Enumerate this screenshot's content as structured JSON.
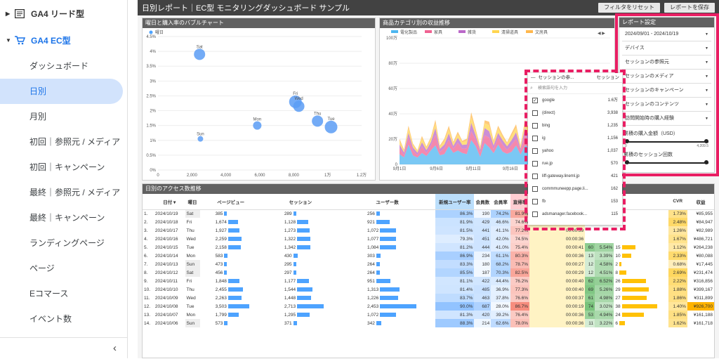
{
  "sidebar": {
    "group1": "GA4 リード型",
    "group2": "GA4 EC型",
    "items": [
      "ダッシュボード",
      "日別",
      "月別",
      "初回｜参照元 / メディア",
      "初回｜キャンペーン",
      "最終｜参照元 / メディア",
      "最終｜キャンペーン",
      "ランディングページ",
      "ページ",
      "Eコマース",
      "イベント数"
    ],
    "collapse": "‹"
  },
  "header": {
    "title": "日別レポート｜EC型 モニタリングダッシュボード サンプル",
    "reset": "フィルタをリセット",
    "save": "レポートを保存"
  },
  "bubble": {
    "title": "曜日と購入率のバブルチャート",
    "legend": "曜日",
    "yticks": [
      "4.5%",
      "4%",
      "3.5%",
      "3%",
      "2.5%",
      "2%",
      "1.5%",
      "1%",
      "0.5%",
      "0%"
    ],
    "xticks": [
      "0",
      "2,000",
      "4,000",
      "6,000",
      "8,000",
      "1万",
      "1.2万"
    ],
    "points": [
      {
        "label": "Sat",
        "x": 2450,
        "y": 3.9,
        "r": 8
      },
      {
        "label": "Sun",
        "x": 2500,
        "y": 1.05,
        "r": 4
      },
      {
        "label": "Mon",
        "x": 5850,
        "y": 1.5,
        "r": 6
      },
      {
        "label": "Fri",
        "x": 8100,
        "y": 2.3,
        "r": 9
      },
      {
        "label": "Wed",
        "x": 8300,
        "y": 2.15,
        "r": 8
      },
      {
        "label": "Thu",
        "x": 9400,
        "y": 1.65,
        "r": 8
      },
      {
        "label": "Tue",
        "x": 10200,
        "y": 1.45,
        "r": 9
      }
    ]
  },
  "area": {
    "title": "商品カテゴリ別の収益推移",
    "legend": [
      "電化製品",
      "家具",
      "雑貨",
      "清掃道具",
      "文房具"
    ],
    "colors": [
      "#4db6f0",
      "#f06292",
      "#ba68c8",
      "#ffd54f",
      "#ffb74d"
    ],
    "yticks": [
      "100万",
      "80万",
      "60万",
      "40万",
      "20万",
      "0"
    ],
    "xticks": [
      "9月1日",
      "9月6日",
      "9月11日",
      "9月16日",
      "9月21日",
      "9月26日"
    ],
    "pager": "◀ ▶"
  },
  "settings": {
    "title": "レポート設定",
    "date": "2024/09/01 - 2024/10/19",
    "filters": [
      "デバイス",
      "セッションの参照元",
      "セッションのメディア",
      "セッションのキャンペーン",
      "セッションのコンテンツ",
      "訪問開始時の購入経験"
    ],
    "slider1": "累積の購入金額（USD）",
    "slider1_nums": [
      "0",
      "4,209.5"
    ],
    "slider2": "累積のセッション回数"
  },
  "dropdown": {
    "header": "セッションの参...",
    "header2": "セッション",
    "search": "検索語句を入力",
    "items": [
      {
        "name": "google",
        "value": "1.6万",
        "checked": "✓"
      },
      {
        "name": "(direct)",
        "value": "3,938",
        "checked": ""
      },
      {
        "name": "bing",
        "value": "1,235",
        "checked": ""
      },
      {
        "name": "ig",
        "value": "1,156",
        "checked": ""
      },
      {
        "name": "yahoo",
        "value": "1,037",
        "checked": ""
      },
      {
        "name": "rue.jp",
        "value": "570",
        "checked": ""
      },
      {
        "name": "liff-gateway.lineml.jp",
        "value": "421",
        "checked": ""
      },
      {
        "name": "commmuneepp.page.li...",
        "value": "162",
        "checked": ""
      },
      {
        "name": "fb",
        "value": "153",
        "checked": ""
      },
      {
        "name": "adsmanager.facebook...",
        "value": "115",
        "checked": ""
      }
    ]
  },
  "table": {
    "title": "日別のアクセス数推移",
    "headers": [
      "",
      "日付 ▾",
      "曜日",
      "ページビュー",
      "セッション",
      "ユーザー数",
      "新規ユーザー率",
      "会員数",
      "会員率",
      "直帰率",
      "エンゲージメント時間",
      "",
      "",
      "",
      "CVR",
      "収益"
    ],
    "rows": [
      [
        "1.",
        "2024/10/19",
        "Sat",
        "385",
        "289",
        "256",
        "86.3%",
        "190",
        "74.2%",
        "81.9%",
        "00:00:36",
        "",
        "",
        "",
        "1.73%",
        "¥85,955"
      ],
      [
        "2.",
        "2024/10/18",
        "Fri",
        "1,674",
        "1,128",
        "921",
        "81.9%",
        "429",
        "46.6%",
        "74.6%",
        "00:00:36",
        "",
        "",
        "",
        "2.48%",
        "¥84,947"
      ],
      [
        "3.",
        "2024/10/17",
        "Thu",
        "1,927",
        "1,273",
        "1,072",
        "81.5%",
        "441",
        "41.1%",
        "77.2%",
        "00:00:39",
        "",
        "",
        "",
        "1.26%",
        "¥82,989"
      ],
      [
        "4.",
        "2024/10/16",
        "Wed",
        "2,259",
        "1,322",
        "1,077",
        "79.3%",
        "451",
        "42.0%",
        "74.5%",
        "00:00:36",
        "",
        "",
        "",
        "1.67%",
        "¥486,721"
      ],
      [
        "5.",
        "2024/10/15",
        "Tue",
        "2,158",
        "1,342",
        "1,084",
        "81.2%",
        "444",
        "41.0%",
        "75.4%",
        "00:00:41",
        "60",
        "5.54%",
        "15",
        "1.12%",
        "¥264,238"
      ],
      [
        "6.",
        "2024/10/14",
        "Mon",
        "583",
        "430",
        "303",
        "86.9%",
        "234",
        "61.1%",
        "80.3%",
        "00:00:36",
        "13",
        "3.39%",
        "10",
        "2.33%",
        "¥80,088"
      ],
      [
        "7.",
        "2024/10/13",
        "Sun",
        "473",
        "295",
        "264",
        "83.3%",
        "180",
        "68.2%",
        "78.7%",
        "00:00:27",
        "12",
        "4.58%",
        "2",
        "0.68%",
        "¥17,445"
      ],
      [
        "8.",
        "2024/10/12",
        "Sat",
        "456",
        "297",
        "264",
        "85.5%",
        "187",
        "70.3%",
        "82.5%",
        "00:00:29",
        "12",
        "4.51%",
        "8",
        "2.69%",
        "¥231,474"
      ],
      [
        "9.",
        "2024/10/11",
        "Fri",
        "1,848",
        "1,177",
        "951",
        "81.1%",
        "422",
        "44.4%",
        "76.2%",
        "00:00:40",
        "62",
        "6.52%",
        "26",
        "2.22%",
        "¥316,856"
      ],
      [
        "10.",
        "2024/10/10",
        "Thu",
        "2,455",
        "1,544",
        "1,313",
        "81.4%",
        "485",
        "36.9%",
        "77.3%",
        "00:00:40",
        "69",
        "5.26%",
        "29",
        "1.88%",
        "¥399,167"
      ],
      [
        "11.",
        "2024/10/09",
        "Wed",
        "2,263",
        "1,448",
        "1,226",
        "83.7%",
        "463",
        "37.8%",
        "76.6%",
        "00:00:37",
        "61",
        "4.98%",
        "27",
        "1.86%",
        "¥311,899"
      ],
      [
        "12.",
        "2024/10/08",
        "Tue",
        "3,503",
        "2,713",
        "2,453",
        "90.0%",
        "687",
        "28.0%",
        "86.7%",
        "00:00:19",
        "74",
        "3.02%",
        "38",
        "1.40%",
        "¥926,700"
      ],
      [
        "13.",
        "2024/10/07",
        "Mon",
        "1,799",
        "1,295",
        "1,072",
        "81.3%",
        "420",
        "39.2%",
        "76.4%",
        "00:00:36",
        "53",
        "4.94%",
        "24",
        "1.85%",
        "¥161,188"
      ],
      [
        "14.",
        "2024/10/06",
        "Sun",
        "573",
        "371",
        "342",
        "88.3%",
        "214",
        "62.6%",
        "78.0%",
        "00:00:36",
        "11",
        "3.22%",
        "6",
        "1.62%",
        "¥161,718"
      ]
    ]
  }
}
